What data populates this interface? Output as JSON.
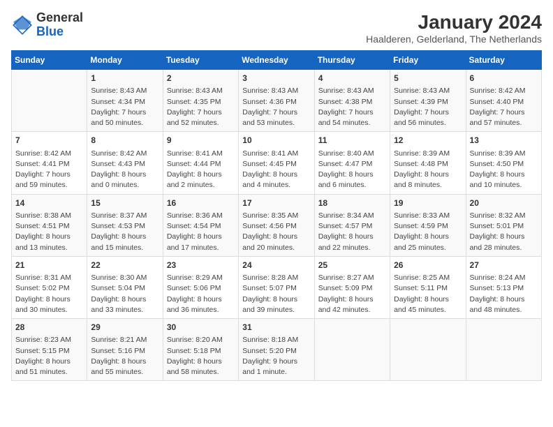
{
  "header": {
    "logo_general": "General",
    "logo_blue": "Blue",
    "month_title": "January 2024",
    "location": "Haalderen, Gelderland, The Netherlands"
  },
  "columns": [
    "Sunday",
    "Monday",
    "Tuesday",
    "Wednesday",
    "Thursday",
    "Friday",
    "Saturday"
  ],
  "weeks": [
    [
      {
        "day": "",
        "content": ""
      },
      {
        "day": "1",
        "content": "Sunrise: 8:43 AM\nSunset: 4:34 PM\nDaylight: 7 hours\nand 50 minutes."
      },
      {
        "day": "2",
        "content": "Sunrise: 8:43 AM\nSunset: 4:35 PM\nDaylight: 7 hours\nand 52 minutes."
      },
      {
        "day": "3",
        "content": "Sunrise: 8:43 AM\nSunset: 4:36 PM\nDaylight: 7 hours\nand 53 minutes."
      },
      {
        "day": "4",
        "content": "Sunrise: 8:43 AM\nSunset: 4:38 PM\nDaylight: 7 hours\nand 54 minutes."
      },
      {
        "day": "5",
        "content": "Sunrise: 8:43 AM\nSunset: 4:39 PM\nDaylight: 7 hours\nand 56 minutes."
      },
      {
        "day": "6",
        "content": "Sunrise: 8:42 AM\nSunset: 4:40 PM\nDaylight: 7 hours\nand 57 minutes."
      }
    ],
    [
      {
        "day": "7",
        "content": "Sunrise: 8:42 AM\nSunset: 4:41 PM\nDaylight: 7 hours\nand 59 minutes."
      },
      {
        "day": "8",
        "content": "Sunrise: 8:42 AM\nSunset: 4:43 PM\nDaylight: 8 hours\nand 0 minutes."
      },
      {
        "day": "9",
        "content": "Sunrise: 8:41 AM\nSunset: 4:44 PM\nDaylight: 8 hours\nand 2 minutes."
      },
      {
        "day": "10",
        "content": "Sunrise: 8:41 AM\nSunset: 4:45 PM\nDaylight: 8 hours\nand 4 minutes."
      },
      {
        "day": "11",
        "content": "Sunrise: 8:40 AM\nSunset: 4:47 PM\nDaylight: 8 hours\nand 6 minutes."
      },
      {
        "day": "12",
        "content": "Sunrise: 8:39 AM\nSunset: 4:48 PM\nDaylight: 8 hours\nand 8 minutes."
      },
      {
        "day": "13",
        "content": "Sunrise: 8:39 AM\nSunset: 4:50 PM\nDaylight: 8 hours\nand 10 minutes."
      }
    ],
    [
      {
        "day": "14",
        "content": "Sunrise: 8:38 AM\nSunset: 4:51 PM\nDaylight: 8 hours\nand 13 minutes."
      },
      {
        "day": "15",
        "content": "Sunrise: 8:37 AM\nSunset: 4:53 PM\nDaylight: 8 hours\nand 15 minutes."
      },
      {
        "day": "16",
        "content": "Sunrise: 8:36 AM\nSunset: 4:54 PM\nDaylight: 8 hours\nand 17 minutes."
      },
      {
        "day": "17",
        "content": "Sunrise: 8:35 AM\nSunset: 4:56 PM\nDaylight: 8 hours\nand 20 minutes."
      },
      {
        "day": "18",
        "content": "Sunrise: 8:34 AM\nSunset: 4:57 PM\nDaylight: 8 hours\nand 22 minutes."
      },
      {
        "day": "19",
        "content": "Sunrise: 8:33 AM\nSunset: 4:59 PM\nDaylight: 8 hours\nand 25 minutes."
      },
      {
        "day": "20",
        "content": "Sunrise: 8:32 AM\nSunset: 5:01 PM\nDaylight: 8 hours\nand 28 minutes."
      }
    ],
    [
      {
        "day": "21",
        "content": "Sunrise: 8:31 AM\nSunset: 5:02 PM\nDaylight: 8 hours\nand 30 minutes."
      },
      {
        "day": "22",
        "content": "Sunrise: 8:30 AM\nSunset: 5:04 PM\nDaylight: 8 hours\nand 33 minutes."
      },
      {
        "day": "23",
        "content": "Sunrise: 8:29 AM\nSunset: 5:06 PM\nDaylight: 8 hours\nand 36 minutes."
      },
      {
        "day": "24",
        "content": "Sunrise: 8:28 AM\nSunset: 5:07 PM\nDaylight: 8 hours\nand 39 minutes."
      },
      {
        "day": "25",
        "content": "Sunrise: 8:27 AM\nSunset: 5:09 PM\nDaylight: 8 hours\nand 42 minutes."
      },
      {
        "day": "26",
        "content": "Sunrise: 8:25 AM\nSunset: 5:11 PM\nDaylight: 8 hours\nand 45 minutes."
      },
      {
        "day": "27",
        "content": "Sunrise: 8:24 AM\nSunset: 5:13 PM\nDaylight: 8 hours\nand 48 minutes."
      }
    ],
    [
      {
        "day": "28",
        "content": "Sunrise: 8:23 AM\nSunset: 5:15 PM\nDaylight: 8 hours\nand 51 minutes."
      },
      {
        "day": "29",
        "content": "Sunrise: 8:21 AM\nSunset: 5:16 PM\nDaylight: 8 hours\nand 55 minutes."
      },
      {
        "day": "30",
        "content": "Sunrise: 8:20 AM\nSunset: 5:18 PM\nDaylight: 8 hours\nand 58 minutes."
      },
      {
        "day": "31",
        "content": "Sunrise: 8:18 AM\nSunset: 5:20 PM\nDaylight: 9 hours\nand 1 minute."
      },
      {
        "day": "",
        "content": ""
      },
      {
        "day": "",
        "content": ""
      },
      {
        "day": "",
        "content": ""
      }
    ]
  ]
}
